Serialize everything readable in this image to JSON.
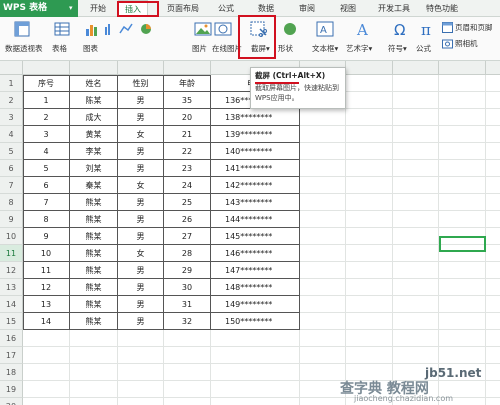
{
  "app": {
    "title": "WPS 表格"
  },
  "menu": {
    "tabs": [
      "开始",
      "插入",
      "页面布局",
      "公式",
      "数据",
      "审阅",
      "视图",
      "开发工具",
      "特色功能"
    ],
    "active_tab": "插入"
  },
  "ribbon": {
    "items": [
      "数据透视表",
      "表格",
      "图表",
      "图片",
      "在线图片",
      "截屏",
      "形状",
      "文本框",
      "艺术字",
      "符号",
      "公式",
      "页眉和页脚",
      "照相机"
    ]
  },
  "tooltip": {
    "title": "截屏 (Ctrl+Alt+X)",
    "body": "截取屏幕图片，快速粘贴到WPS应用中。"
  },
  "sheet": {
    "headers": [
      "序号",
      "姓名",
      "性别",
      "年龄",
      "电话"
    ],
    "rows": [
      [
        "1",
        "陈某",
        "男",
        "35",
        "136********"
      ],
      [
        "2",
        "成大",
        "男",
        "20",
        "138********"
      ],
      [
        "3",
        "黄某",
        "女",
        "21",
        "139********"
      ],
      [
        "4",
        "李某",
        "男",
        "22",
        "140********"
      ],
      [
        "5",
        "刘某",
        "男",
        "23",
        "141********"
      ],
      [
        "6",
        "秦某",
        "女",
        "24",
        "142********"
      ],
      [
        "7",
        "熊某",
        "男",
        "25",
        "143********"
      ],
      [
        "8",
        "熊某",
        "男",
        "26",
        "144********"
      ],
      [
        "9",
        "熊某",
        "男",
        "27",
        "145********"
      ],
      [
        "10",
        "熊某",
        "女",
        "28",
        "146********"
      ],
      [
        "11",
        "熊某",
        "男",
        "29",
        "147********"
      ],
      [
        "12",
        "熊某",
        "男",
        "30",
        "148********"
      ],
      [
        "13",
        "熊某",
        "男",
        "31",
        "149********"
      ],
      [
        "14",
        "熊某",
        "男",
        "32",
        "150********"
      ]
    ],
    "row_numbers": [
      "1",
      "2",
      "3",
      "4",
      "5",
      "6",
      "7",
      "8",
      "9",
      "10",
      "11",
      "12",
      "13",
      "14",
      "15",
      "16",
      "17",
      "18",
      "19",
      "20"
    ],
    "selected_row": "11"
  },
  "watermark": {
    "site": "jb51.net",
    "brand": "查字典 教程网",
    "url": "jiaocheng.chazidian.com"
  },
  "colors": {
    "accent": "#2e9a52",
    "highlight": "#d1101f",
    "selection": "#2fa84f"
  }
}
